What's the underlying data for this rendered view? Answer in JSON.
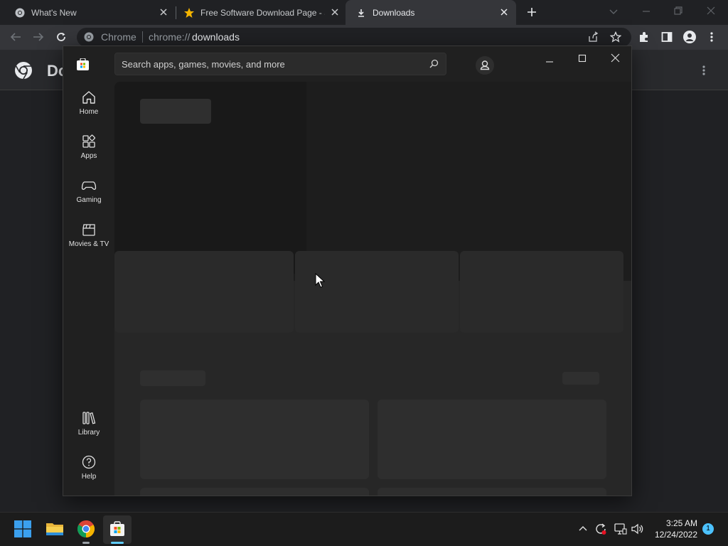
{
  "browser": {
    "tabs": [
      {
        "title": "What's New",
        "icon": "chrome-icon"
      },
      {
        "title": "Free Software Download Page - S",
        "icon": "star-icon"
      },
      {
        "title": "Downloads",
        "icon": "download-icon"
      }
    ],
    "omnibox": {
      "site_label": "Chrome",
      "url_scheme": "chrome://",
      "url_path": "downloads"
    },
    "page_header_partial": "Do"
  },
  "store": {
    "search_placeholder": "Search apps, games, movies, and more",
    "nav": [
      {
        "label": "Home",
        "icon": "home-icon"
      },
      {
        "label": "Apps",
        "icon": "apps-icon"
      },
      {
        "label": "Gaming",
        "icon": "gamepad-icon"
      },
      {
        "label": "Movies & TV",
        "icon": "clapperboard-icon"
      }
    ],
    "nav_bottom": [
      {
        "label": "Library",
        "icon": "library-icon"
      },
      {
        "label": "Help",
        "icon": "help-icon"
      }
    ]
  },
  "taskbar": {
    "time": "3:25 AM",
    "date": "12/24/2022",
    "notification_count": "1"
  },
  "colors": {
    "windows_blue": "#0078d4",
    "chrome_bg": "#202124",
    "store_bg": "#202020"
  }
}
